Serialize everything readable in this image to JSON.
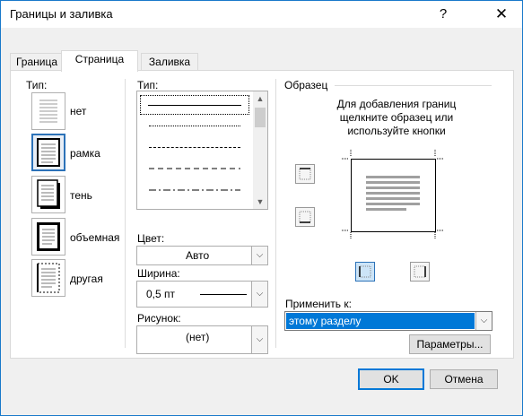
{
  "window": {
    "title": "Границы и заливка",
    "help_glyph": "?",
    "close_glyph": "✕"
  },
  "tabs": [
    {
      "label": "Граница",
      "active": false
    },
    {
      "label": "Страница",
      "active": true
    },
    {
      "label": "Заливка",
      "active": false
    }
  ],
  "settings": {
    "heading": "Тип:",
    "items": [
      {
        "label": "нет",
        "icon": "none-setting-icon",
        "selected": false
      },
      {
        "label": "рамка",
        "icon": "box-setting-icon",
        "selected": true
      },
      {
        "label": "тень",
        "icon": "shadow-setting-icon",
        "selected": false
      },
      {
        "label": "объемная",
        "icon": "3d-setting-icon",
        "selected": false
      },
      {
        "label": "другая",
        "icon": "custom-setting-icon",
        "selected": false
      }
    ]
  },
  "style": {
    "heading": "Тип:",
    "items": [
      "solid",
      "dotted",
      "dashed-small",
      "dashed",
      "dash-dot"
    ],
    "selected_index": 0
  },
  "color": {
    "label": "Цвет:",
    "value": "Авто"
  },
  "width": {
    "label": "Ширина:",
    "value": "0,5 пт"
  },
  "art": {
    "label": "Рисунок:",
    "value": "(нет)"
  },
  "preview": {
    "heading": "Образец",
    "hint": [
      "Для добавления границ",
      "щелкните образец или",
      "используйте кнопки"
    ]
  },
  "apply_to": {
    "label": "Применить к:",
    "value": "этому разделу"
  },
  "buttons": {
    "options": "Параметры...",
    "ok": "OK",
    "cancel": "Отмена"
  },
  "colors": {
    "accent": "#0078d7",
    "selection": "#0078d7",
    "selection_text": "#ffffff"
  }
}
